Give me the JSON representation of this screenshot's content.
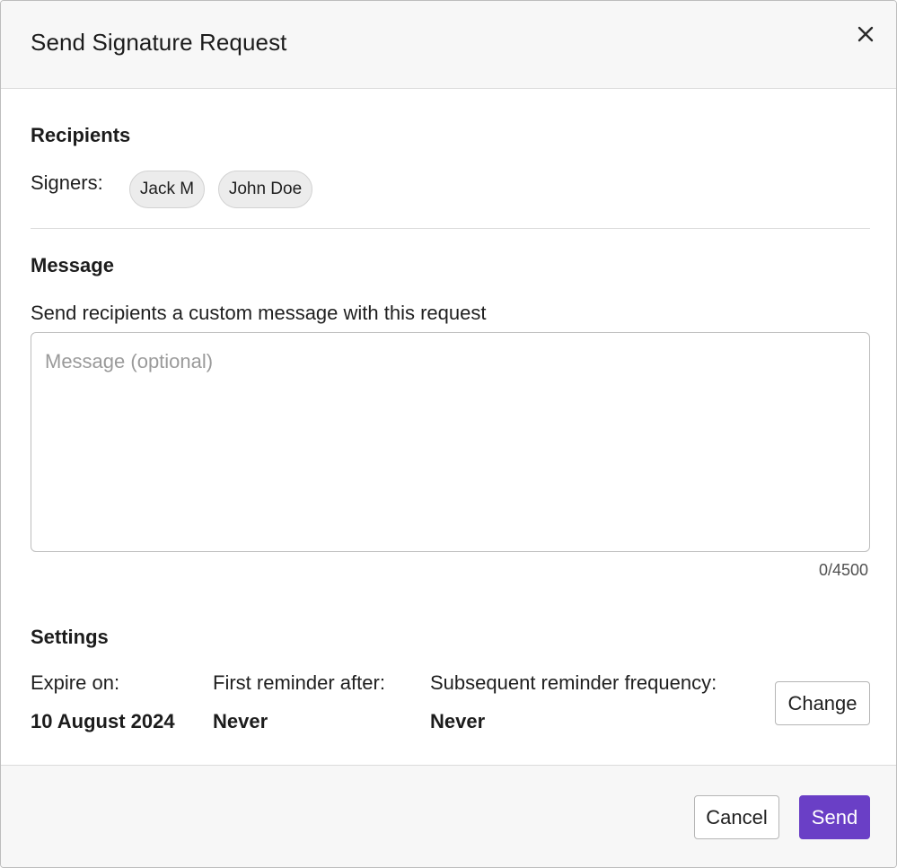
{
  "dialog": {
    "title": "Send Signature Request",
    "close_icon": "close-icon"
  },
  "recipients": {
    "heading": "Recipients",
    "signers_label": "Signers:",
    "signers": [
      "Jack M",
      "John Doe"
    ]
  },
  "message": {
    "heading": "Message",
    "description": "Send recipients a custom message with this request",
    "value": "",
    "placeholder": "Message (optional)",
    "counter": "0/4500"
  },
  "settings": {
    "heading": "Settings",
    "expire_label": "Expire on:",
    "expire_value": "10 August 2024",
    "first_reminder_label": "First reminder after:",
    "first_reminder_value": "Never",
    "subsequent_label": "Subsequent reminder frequency:",
    "subsequent_value": "Never",
    "change_label": "Change"
  },
  "footer": {
    "cancel_label": "Cancel",
    "send_label": "Send"
  },
  "colors": {
    "accent": "#6a3fc6",
    "header_bg": "#f7f7f7",
    "chip_bg": "#ececec"
  }
}
